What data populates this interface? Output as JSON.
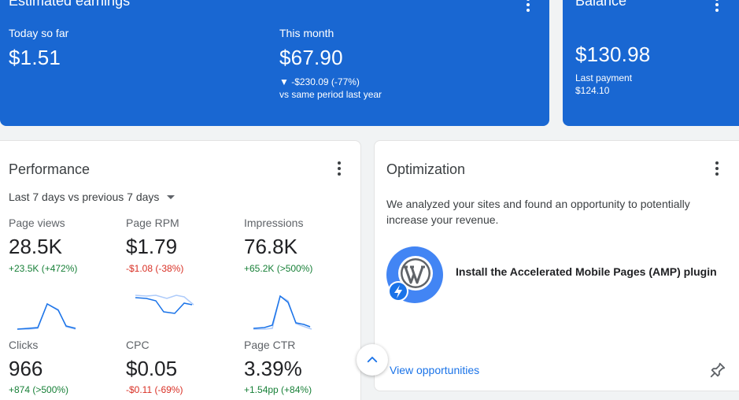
{
  "earnings": {
    "title": "Estimated earnings",
    "today_label": "Today so far",
    "today_value": "$1.51",
    "month_label": "This month",
    "month_value": "$67.90",
    "month_delta": "▼ -$230.09 (-77%)",
    "month_compare": "vs same period last year"
  },
  "balance": {
    "title": "Balance",
    "value": "$130.98",
    "last_payment_label": "Last payment",
    "last_payment_value": "$124.10"
  },
  "performance": {
    "title": "Performance",
    "range": "Last 7 days vs previous 7 days",
    "metrics": [
      {
        "label": "Page views",
        "value": "28.5K",
        "delta": "+23.5K (+472%)",
        "trend": "up"
      },
      {
        "label": "Page RPM",
        "value": "$1.79",
        "delta": "-$1.08 (-38%)",
        "trend": "down"
      },
      {
        "label": "Impressions",
        "value": "76.8K",
        "delta": "+65.2K (>500%)",
        "trend": "up"
      },
      {
        "label": "Clicks",
        "value": "966",
        "delta": "+874 (>500%)",
        "trend": "up"
      },
      {
        "label": "CPC",
        "value": "$0.05",
        "delta": "-$0.11 (-69%)",
        "trend": "down"
      },
      {
        "label": "Page CTR",
        "value": "3.39%",
        "delta": "+1.54pp (+84%)",
        "trend": "up"
      }
    ]
  },
  "optimization": {
    "title": "Optimization",
    "description": "We analyzed your sites and found an opportunity to potentially increase your revenue.",
    "item_title": "Install the Accelerated Mobile Pages (AMP) plugin",
    "link": "View opportunities"
  },
  "colors": {
    "primary_blue": "#1967d2",
    "link_blue": "#1a73e8",
    "positive": "#188038",
    "negative": "#d93025"
  }
}
